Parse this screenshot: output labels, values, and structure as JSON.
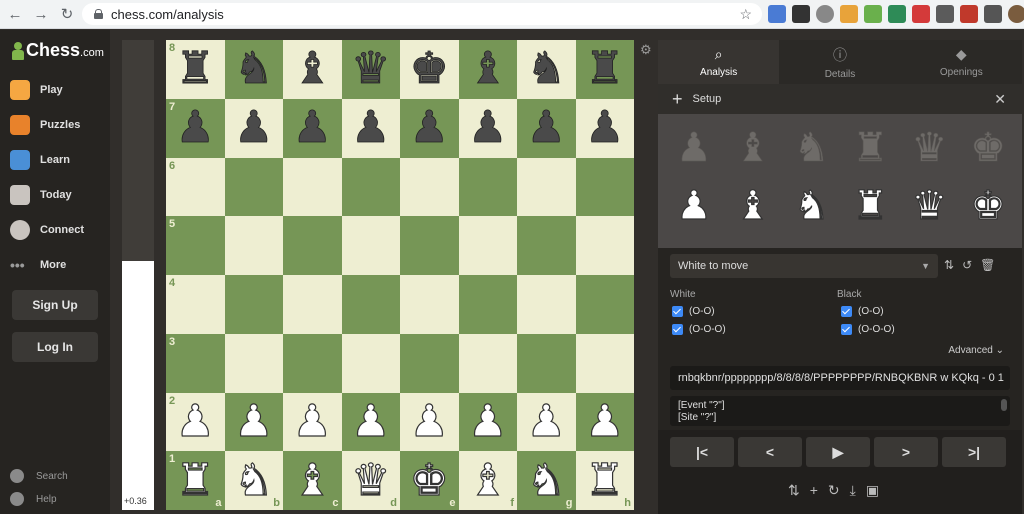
{
  "browser": {
    "url": "chess.com/analysis",
    "back_icon": "←",
    "forward_icon": "→",
    "reload_icon": "↻",
    "star_icon": "☆"
  },
  "sidebar": {
    "logo_text": "Chess",
    "logo_suffix": ".com",
    "items": [
      {
        "label": "Play",
        "color": "#f5a742"
      },
      {
        "label": "Puzzles",
        "color": "#e8822b"
      },
      {
        "label": "Learn",
        "color": "#4a8fd6"
      },
      {
        "label": "Today",
        "color": "#c9c4bf"
      },
      {
        "label": "Connect",
        "color": "#c9c4bf"
      },
      {
        "label": "More",
        "color": "#9a9a9a"
      }
    ],
    "signup_label": "Sign Up",
    "login_label": "Log In",
    "search_label": "Search",
    "help_label": "Help"
  },
  "evaluation": {
    "score": "+0.36",
    "white_fraction": 0.53
  },
  "board": {
    "orientation": "white",
    "position": [
      [
        "r",
        "n",
        "b",
        "q",
        "k",
        "b",
        "n",
        "r"
      ],
      [
        "p",
        "p",
        "p",
        "p",
        "p",
        "p",
        "p",
        "p"
      ],
      [
        "",
        "",
        "",
        "",
        "",
        "",
        "",
        ""
      ],
      [
        "",
        "",
        "",
        "",
        "",
        "",
        "",
        ""
      ],
      [
        "",
        "",
        "",
        "",
        "",
        "",
        "",
        ""
      ],
      [
        "",
        "",
        "",
        "",
        "",
        "",
        "",
        ""
      ],
      [
        "P",
        "P",
        "P",
        "P",
        "P",
        "P",
        "P",
        "P"
      ],
      [
        "R",
        "N",
        "B",
        "Q",
        "K",
        "B",
        "N",
        "R"
      ]
    ],
    "ranks": [
      "8",
      "7",
      "6",
      "5",
      "4",
      "3",
      "2",
      "1"
    ],
    "files": [
      "a",
      "b",
      "c",
      "d",
      "e",
      "f",
      "g",
      "h"
    ],
    "light_color": "#eeeed2",
    "dark_color": "#769656"
  },
  "panel": {
    "tabs": [
      {
        "label": "Analysis",
        "icon": "search-icon",
        "active": true
      },
      {
        "label": "Details",
        "icon": "info-icon",
        "active": false
      },
      {
        "label": "Openings",
        "icon": "book-icon",
        "active": false
      }
    ],
    "setup_title": "Setup",
    "side_to_move": "White to move",
    "white_label": "White",
    "black_label": "Black",
    "castling": {
      "white_short": "(O-O)",
      "white_long": "(O-O-O)",
      "black_short": "(O-O)",
      "black_long": "(O-O-O)"
    },
    "advanced_label": "Advanced ⌄",
    "fen": "rnbqkbnr/pppppppp/8/8/8/8/PPPPPPPP/RNBQKBNR w KQkq - 0 1",
    "pgn_line1": "[Event \"?\"]",
    "pgn_line2": "[Site \"?\"]"
  }
}
